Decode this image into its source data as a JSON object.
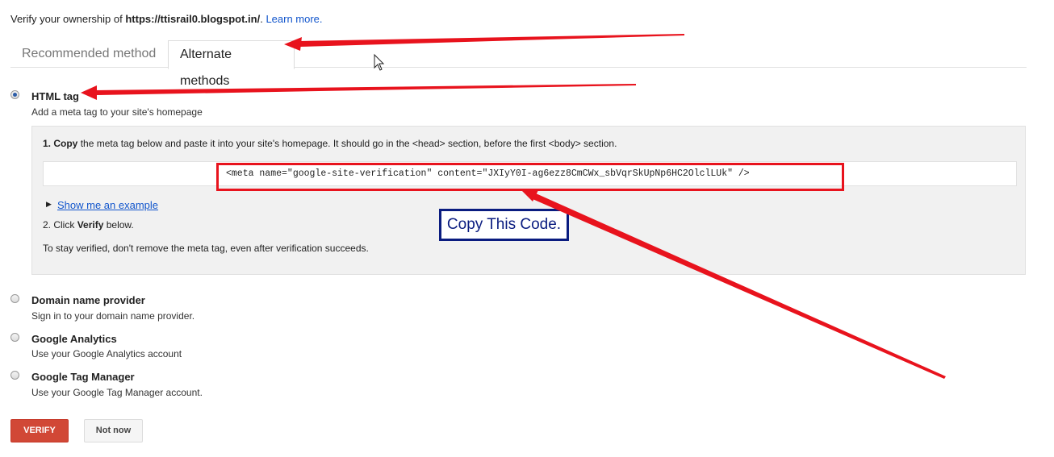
{
  "header": {
    "prefix": "Verify your ownership of ",
    "site": "https://ttisrail0.blogspot.in/",
    "suffix": ". ",
    "learn_more": "Learn more."
  },
  "tabs": [
    {
      "label": "Recommended method",
      "active": false
    },
    {
      "label": "Alternate methods",
      "active": true
    }
  ],
  "options": [
    {
      "title": "HTML tag",
      "desc": "Add a meta tag to your site's homepage",
      "checked": true
    },
    {
      "title": "Domain name provider",
      "desc": "Sign in to your domain name provider.",
      "checked": false
    },
    {
      "title": "Google Analytics",
      "desc": "Use your Google Analytics account",
      "checked": false
    },
    {
      "title": "Google Tag Manager",
      "desc": "Use your Google Tag Manager account.",
      "checked": false
    }
  ],
  "html_tag_panel": {
    "step1_num": "1.",
    "step1_bold": "Copy",
    "step1_text": " the meta tag below and paste it into your site's homepage. It should go in the <head> section, before the first <body> section.",
    "meta_tag": "<meta name=\"google-site-verification\" content=\"JXIyY0I-ag6ezz8CmCWx_sbVqrSkUpNp6HC2OlclLUk\" />",
    "show_example": "Show me an example",
    "step2_prefix": "2. Click ",
    "step2_bold": "Verify",
    "step2_suffix": " below.",
    "note": "To stay verified, don't remove the meta tag, even after verification succeeds."
  },
  "annotation": {
    "callout": "Copy This Code.",
    "arrow_color": "#e8131d",
    "callout_color": "#0a1c80"
  },
  "buttons": {
    "verify": "VERIFY",
    "not_now": "Not now"
  }
}
